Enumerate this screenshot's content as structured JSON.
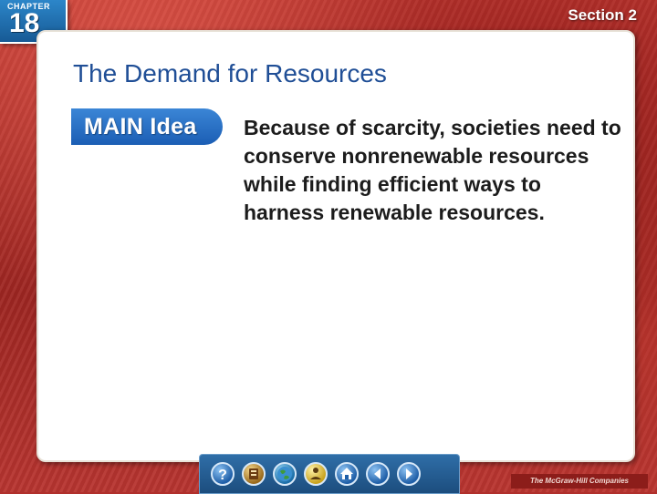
{
  "header": {
    "chapter_label": "CHAPTER",
    "chapter_number": "18",
    "section": "Section 2"
  },
  "slide": {
    "title": "The Demand for Resources",
    "badge": "MAIN Idea",
    "main_idea": "Because of scarcity, societies need to conserve nonrenewable resources while finding efficient ways to harness renewable resources."
  },
  "nav": {
    "buttons": [
      "help-icon",
      "resources-icon",
      "globe-icon",
      "reader-icon",
      "home-icon",
      "back-icon",
      "forward-icon"
    ]
  },
  "footer": {
    "publisher": "The McGraw-Hill Companies"
  }
}
